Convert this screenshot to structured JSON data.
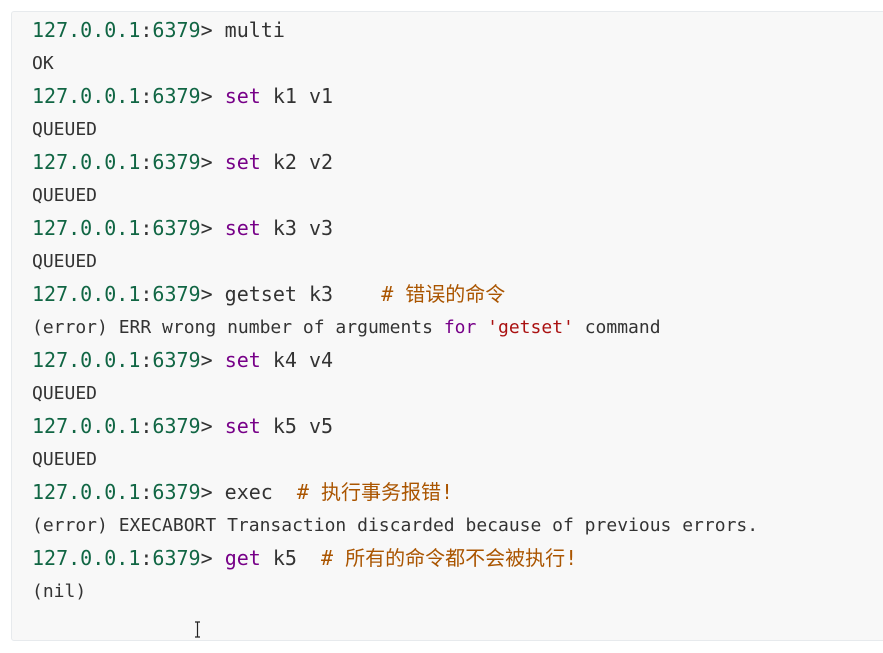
{
  "lines": [
    {
      "kind": "command",
      "parts": [
        [
          "num",
          "127.0.0.1"
        ],
        [
          "",
          ":"
        ],
        [
          "num",
          "6379"
        ],
        [
          "",
          "> multi"
        ]
      ]
    },
    {
      "kind": "output",
      "parts": [
        [
          "",
          "OK"
        ]
      ]
    },
    {
      "kind": "command",
      "parts": [
        [
          "num",
          "127.0.0.1"
        ],
        [
          "",
          ":"
        ],
        [
          "num",
          "6379"
        ],
        [
          "",
          "> "
        ],
        [
          "kw",
          "set"
        ],
        [
          "",
          " k1 v1"
        ]
      ]
    },
    {
      "kind": "output",
      "parts": [
        [
          "",
          "QUEUED"
        ]
      ]
    },
    {
      "kind": "command",
      "parts": [
        [
          "num",
          "127.0.0.1"
        ],
        [
          "",
          ":"
        ],
        [
          "num",
          "6379"
        ],
        [
          "",
          "> "
        ],
        [
          "kw",
          "set"
        ],
        [
          "",
          " k2 v2"
        ]
      ]
    },
    {
      "kind": "output",
      "parts": [
        [
          "",
          "QUEUED"
        ]
      ]
    },
    {
      "kind": "command",
      "parts": [
        [
          "num",
          "127.0.0.1"
        ],
        [
          "",
          ":"
        ],
        [
          "num",
          "6379"
        ],
        [
          "",
          "> "
        ],
        [
          "kw",
          "set"
        ],
        [
          "",
          " k3 v3"
        ]
      ]
    },
    {
      "kind": "output",
      "parts": [
        [
          "",
          "QUEUED"
        ]
      ]
    },
    {
      "kind": "command",
      "parts": [
        [
          "num",
          "127.0.0.1"
        ],
        [
          "",
          ":"
        ],
        [
          "num",
          "6379"
        ],
        [
          "",
          "> getset k3    "
        ],
        [
          "cm",
          "# 错误的命令"
        ]
      ]
    },
    {
      "kind": "output",
      "parts": [
        [
          "",
          "(error) ERR wrong number of arguments "
        ],
        [
          "kw",
          "for"
        ],
        [
          "",
          " "
        ],
        [
          "str",
          "'getset'"
        ],
        [
          "",
          " command"
        ]
      ]
    },
    {
      "kind": "command",
      "parts": [
        [
          "num",
          "127.0.0.1"
        ],
        [
          "",
          ":"
        ],
        [
          "num",
          "6379"
        ],
        [
          "",
          "> "
        ],
        [
          "kw",
          "set"
        ],
        [
          "",
          " k4 v4"
        ]
      ]
    },
    {
      "kind": "output",
      "parts": [
        [
          "",
          "QUEUED"
        ]
      ]
    },
    {
      "kind": "command",
      "parts": [
        [
          "num",
          "127.0.0.1"
        ],
        [
          "",
          ":"
        ],
        [
          "num",
          "6379"
        ],
        [
          "",
          "> "
        ],
        [
          "kw",
          "set"
        ],
        [
          "",
          " k5 v5"
        ]
      ]
    },
    {
      "kind": "output",
      "parts": [
        [
          "",
          "QUEUED"
        ]
      ]
    },
    {
      "kind": "command",
      "parts": [
        [
          "num",
          "127.0.0.1"
        ],
        [
          "",
          ":"
        ],
        [
          "num",
          "6379"
        ],
        [
          "",
          "> exec  "
        ],
        [
          "cm",
          "# 执行事务报错!"
        ]
      ]
    },
    {
      "kind": "output",
      "parts": [
        [
          "",
          "(error) EXECABORT Transaction discarded because of previous errors."
        ]
      ]
    },
    {
      "kind": "command",
      "parts": [
        [
          "num",
          "127.0.0.1"
        ],
        [
          "",
          ":"
        ],
        [
          "num",
          "6379"
        ],
        [
          "",
          "> "
        ],
        [
          "kw",
          "get"
        ],
        [
          "",
          " k5  "
        ],
        [
          "cm",
          "# 所有的命令都不会被执行!"
        ]
      ]
    },
    {
      "kind": "output",
      "parts": [
        [
          "",
          "(nil)"
        ]
      ]
    }
  ],
  "icons": {
    "cursor": "text-cursor-icon"
  }
}
